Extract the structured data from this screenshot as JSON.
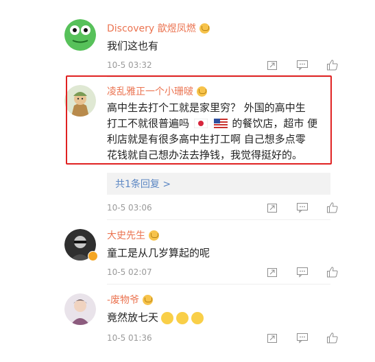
{
  "comments": [
    {
      "username": "Discovery 歆煜凤燃",
      "text": "我们这也有",
      "time": "10-5 03:32"
    },
    {
      "username": "凌乱雅正一个小珊啵",
      "text_parts": [
        "高中生去打个工就是家里穷？ 外国的高中生\n打工不就很普遍吗 ",
        " ",
        " 的餐饮店，超市 便\n利店就是有很多高中生打工啊 自己想多点零\n花钱就自己想办法去挣钱，我觉得挺好的。"
      ],
      "reply_link": "共1条回复 >",
      "time": "10-5 03:06"
    },
    {
      "username": "大史先生",
      "text": "童工是从几岁算起的呢",
      "time": "10-5 02:07"
    },
    {
      "username": "-废物爷",
      "text": "竟然放七天",
      "time": "10-5 01:36"
    }
  ],
  "icons": [
    "share-icon",
    "comment-icon",
    "like-icon",
    "crown-badge-icon",
    "verified-badge-icon",
    "japan-flag-icon",
    "us-flag-icon",
    "smile-face-icon"
  ],
  "colors": {
    "username": "#eb7350",
    "highlight": "#e02020",
    "reply_link": "#5b86c3",
    "meta": "#999999"
  }
}
